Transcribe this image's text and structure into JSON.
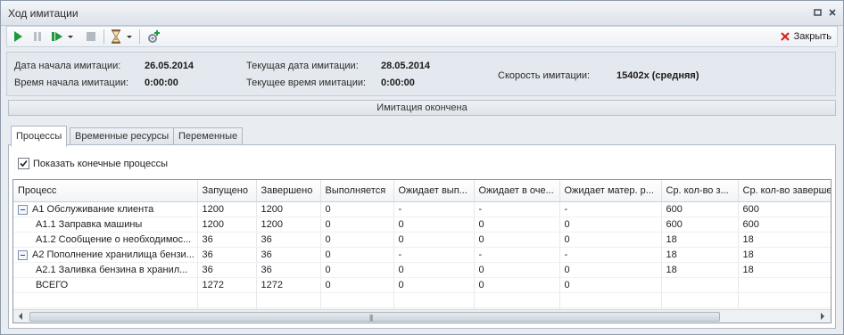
{
  "window": {
    "title": "Ход имитации"
  },
  "toolbar": {
    "close_label": "Закрыть"
  },
  "info": {
    "start_date_label": "Дата начала имитации:",
    "start_date": "26.05.2014",
    "start_time_label": "Время начала имитации:",
    "start_time": "0:00:00",
    "current_date_label": "Текущая дата имитации:",
    "current_date": "28.05.2014",
    "current_time_label": "Текущее время имитации:",
    "current_time": "0:00:00",
    "speed_label": "Скорость имитации:",
    "speed": "15402x (средняя)"
  },
  "status": {
    "text": "Имитация окончена"
  },
  "tabs": [
    "Процессы",
    "Временные ресурсы",
    "Переменные"
  ],
  "options": {
    "show_final_label": "Показать конечные процессы",
    "show_final_checked": true
  },
  "grid": {
    "columns": [
      "Процесс",
      "Запущено",
      "Завершено",
      "Выполняется",
      "Ожидает вып...",
      "Ожидает в оче...",
      "Ожидает матер. р...",
      "Ср. кол-во з...",
      "Ср. кол-во заверше"
    ],
    "rows": [
      {
        "name": "А1 Обслуживание клиента",
        "level": 0,
        "expander": true,
        "cells": [
          "1200",
          "1200",
          "0",
          "-",
          "-",
          "-",
          "600",
          "600"
        ]
      },
      {
        "name": "А1.1 Заправка машины",
        "level": 1,
        "expander": false,
        "cells": [
          "1200",
          "1200",
          "0",
          "0",
          "0",
          "0",
          "600",
          "600"
        ]
      },
      {
        "name": "А1.2 Сообщение о необходимос...",
        "level": 1,
        "expander": false,
        "cells": [
          "36",
          "36",
          "0",
          "0",
          "0",
          "0",
          "18",
          "18"
        ]
      },
      {
        "name": "А2 Пополнение хранилища бензи...",
        "level": 0,
        "expander": true,
        "cells": [
          "36",
          "36",
          "0",
          "-",
          "-",
          "-",
          "18",
          "18"
        ]
      },
      {
        "name": "А2.1 Заливка бензина в хранил...",
        "level": 1,
        "expander": false,
        "cells": [
          "36",
          "36",
          "0",
          "0",
          "0",
          "0",
          "18",
          "18"
        ]
      },
      {
        "name": "ВСЕГО",
        "level": 1,
        "expander": false,
        "cells": [
          "1272",
          "1272",
          "0",
          "0",
          "0",
          "0",
          "",
          ""
        ]
      }
    ]
  },
  "colors": {
    "play_green": "#1c9a3c",
    "close_red": "#d8241b",
    "accent_blue": "#3a6fb0"
  }
}
